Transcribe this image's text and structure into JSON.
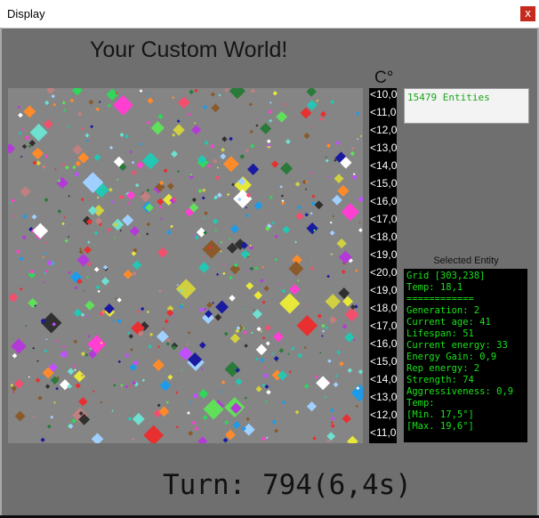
{
  "window": {
    "title": "Display",
    "close_label": "x"
  },
  "heading": "Your Custom World!",
  "temperature_scale": {
    "unit": "C°",
    "ticks": [
      "<10,0",
      "<11,0",
      "<12,0",
      "<13,0",
      "<14,0",
      "<15,0",
      "<16,0",
      "<17,0",
      "<18,0",
      "<19,0",
      "<20,0",
      "<19,0",
      "<18,0",
      "<17,0",
      "<16,0",
      "<15,0",
      "<14,0",
      "<13,0",
      "<12,0",
      "<11,0"
    ]
  },
  "entity_count": "15479 Entities",
  "selected_entity": {
    "label": "Selected Entity",
    "lines": [
      "Grid [303,238]",
      "Temp: 18,1",
      "============",
      "Generation: 2",
      "Current age: 41",
      "Lifespan: 51",
      "Current energy: 33",
      "Energy Gain: 0,9",
      "Rep energy: 2",
      "Strength: 74",
      "Aggressiveness: 0,9",
      "Temp:",
      "[Min. 17,5°]",
      "[Max. 19,6°]"
    ]
  },
  "turn": "Turn: 794(6,4s)",
  "colors": {
    "world_background": "#858585",
    "palette": [
      "#e83030",
      "#2fd85a",
      "#1e9be8",
      "#e8e83a",
      "#ff3fd2",
      "#b43ad8",
      "#23c7b3",
      "#ff8a2a",
      "#8a5a2a",
      "#1a1aa0",
      "#f24f6e",
      "#60e05a",
      "#d0d040",
      "#a0d0ff",
      "#2a7a3a",
      "#c08080",
      "#ffffff",
      "#303030",
      "#6de0d0",
      "#c050ff"
    ]
  }
}
